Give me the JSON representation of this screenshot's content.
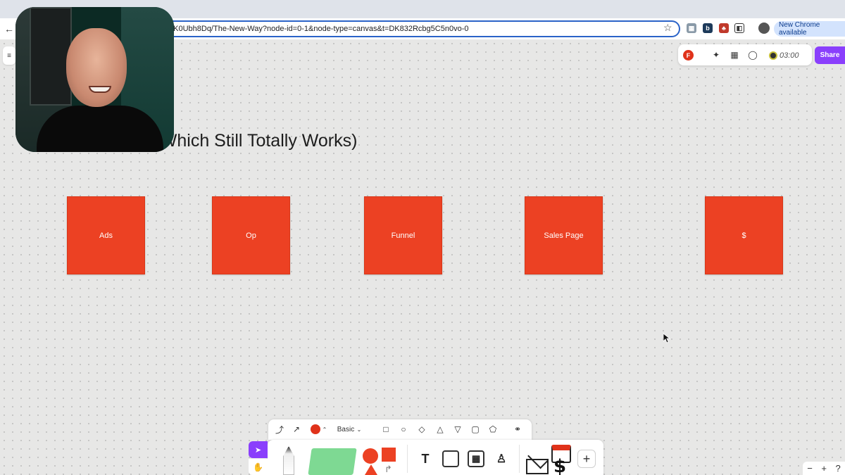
{
  "browser": {
    "url": "5K0Ubh8Dq/The-New-Way?node-id=0-1&node-type=canvas&t=DK832Rcbg5C5n0vo-0",
    "update_label": "New Chrome available",
    "back_icon": "back-arrow-icon",
    "star_icon": "bookmark-star-icon",
    "extensions": [
      "ext-icon-a",
      "ext-icon-b",
      "ext-icon-c",
      "puzzle-icon"
    ]
  },
  "header": {
    "avatar_initial": "F",
    "timer": "03:00",
    "share_label": "Share",
    "icons": [
      "ai-sparkle-icon",
      "layout-icon",
      "comment-icon"
    ]
  },
  "board": {
    "title": "y (Which Still Totally Works)",
    "stickies": [
      {
        "label": "Ads"
      },
      {
        "label": "Op"
      },
      {
        "label": "Funnel"
      },
      {
        "label": "Sales Page"
      },
      {
        "label": "$"
      }
    ],
    "sticky_color": "#ec4123"
  },
  "shape_bar": {
    "style_label": "Basic",
    "shape_color": "#e0321a",
    "shapes": [
      "connector-icon",
      "arrow-icon",
      "square-icon",
      "circle-icon",
      "diamond-icon",
      "triangle-icon",
      "triangle-down-icon",
      "rounded-rect-icon",
      "tag-icon",
      "tree-icon"
    ]
  },
  "main_toolbar": {
    "text_tool": "T",
    "plus_label": "+",
    "accent": "#8a3ffc"
  },
  "zoom": {
    "minus": "−",
    "plus": "+",
    "help": "?"
  }
}
